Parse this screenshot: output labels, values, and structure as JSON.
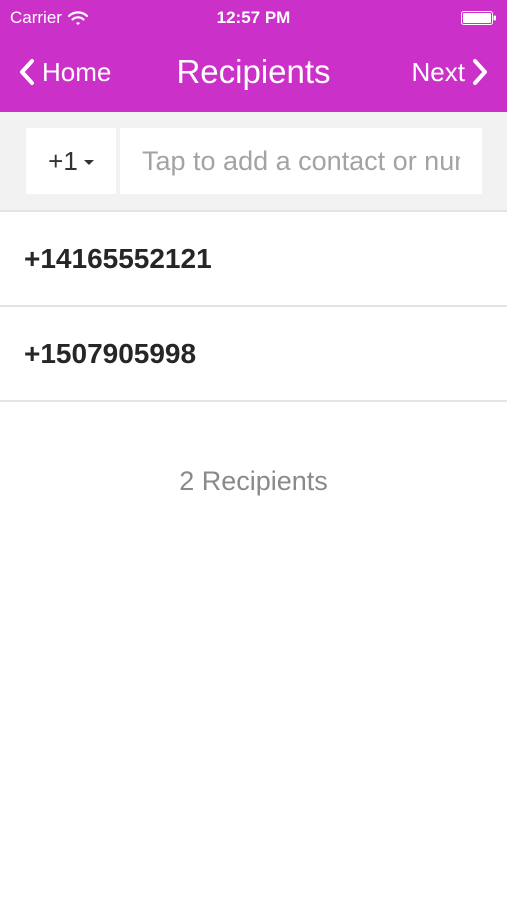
{
  "status_bar": {
    "carrier": "Carrier",
    "time": "12:57 PM",
    "wifi_icon": "wifi-icon",
    "battery_icon": "battery-icon"
  },
  "nav": {
    "back_label": "Home",
    "title": "Recipients",
    "next_label": "Next",
    "back_icon": "chevron-left-icon",
    "next_icon": "chevron-right-icon"
  },
  "search": {
    "country_code": "+1",
    "placeholder": "Tap to add a contact or number",
    "value": ""
  },
  "recipients": [
    {
      "number": "+14165552121"
    },
    {
      "number": "+1507905998"
    }
  ],
  "recipient_count_label": "2 Recipients",
  "colors": {
    "header_bg": "#cb30c9",
    "search_bg": "#f2f2f2",
    "divider": "#e3e3e3"
  }
}
